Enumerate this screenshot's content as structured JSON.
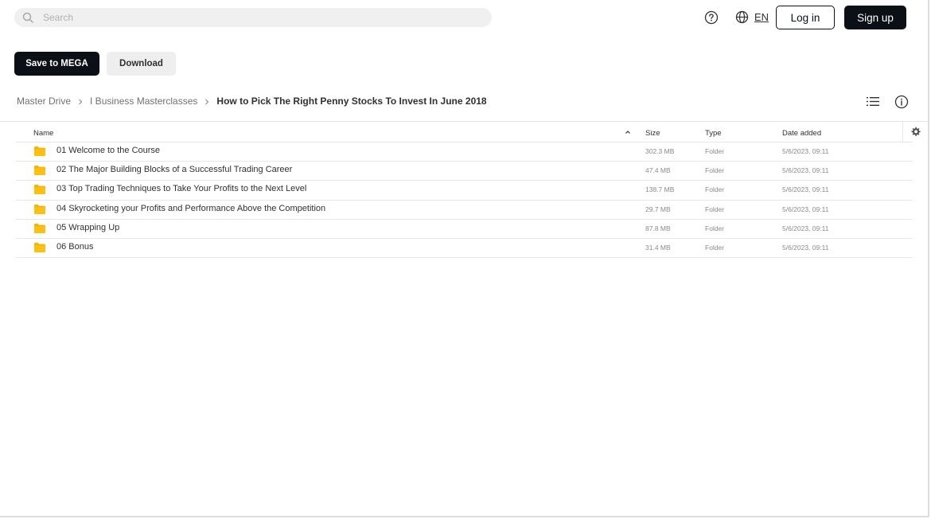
{
  "header": {
    "search_placeholder": "Search",
    "language": "EN",
    "login_label": "Log in",
    "signup_label": "Sign up"
  },
  "actions": {
    "save_label": "Save to MEGA",
    "download_label": "Download"
  },
  "breadcrumb": {
    "items": [
      "Master Drive",
      "I Business Masterclasses",
      "How to Pick The Right Penny Stocks To Invest In June 2018"
    ]
  },
  "table": {
    "headers": {
      "name": "Name",
      "size": "Size",
      "type": "Type",
      "date": "Date added"
    },
    "rows": [
      {
        "name": "01 Welcome to the Course",
        "size": "302.3 MB",
        "type": "Folder",
        "date": "5/6/2023, 09:11"
      },
      {
        "name": "02 The Major Building Blocks of a Successful Trading Career",
        "size": "47.4 MB",
        "type": "Folder",
        "date": "5/6/2023, 09:11"
      },
      {
        "name": "03 Top Trading Techniques to Take Your Profits to the Next Level",
        "size": "138.7 MB",
        "type": "Folder",
        "date": "5/6/2023, 09:11"
      },
      {
        "name": "04 Skyrocketing your Profits and Performance Above the Competition",
        "size": "29.7 MB",
        "type": "Folder",
        "date": "5/6/2023, 09:11"
      },
      {
        "name": "05 Wrapping Up",
        "size": "87.8 MB",
        "type": "Folder",
        "date": "5/6/2023, 09:11"
      },
      {
        "name": "06 Bonus",
        "size": "31.4 MB",
        "type": "Folder",
        "date": "5/6/2023, 09:11"
      }
    ]
  },
  "icons": {
    "search": "search-icon",
    "help": "help-icon",
    "globe": "globe-icon",
    "chevron": "chevron-right-icon",
    "list_view": "list-view-icon",
    "info": "info-icon",
    "sort": "sort-ascending-icon",
    "settings": "gear-icon",
    "folder": "folder-icon"
  },
  "colors": {
    "primary_button": "#0b1016",
    "folder": "#f9b301",
    "search_bg": "#f0f0f0"
  }
}
